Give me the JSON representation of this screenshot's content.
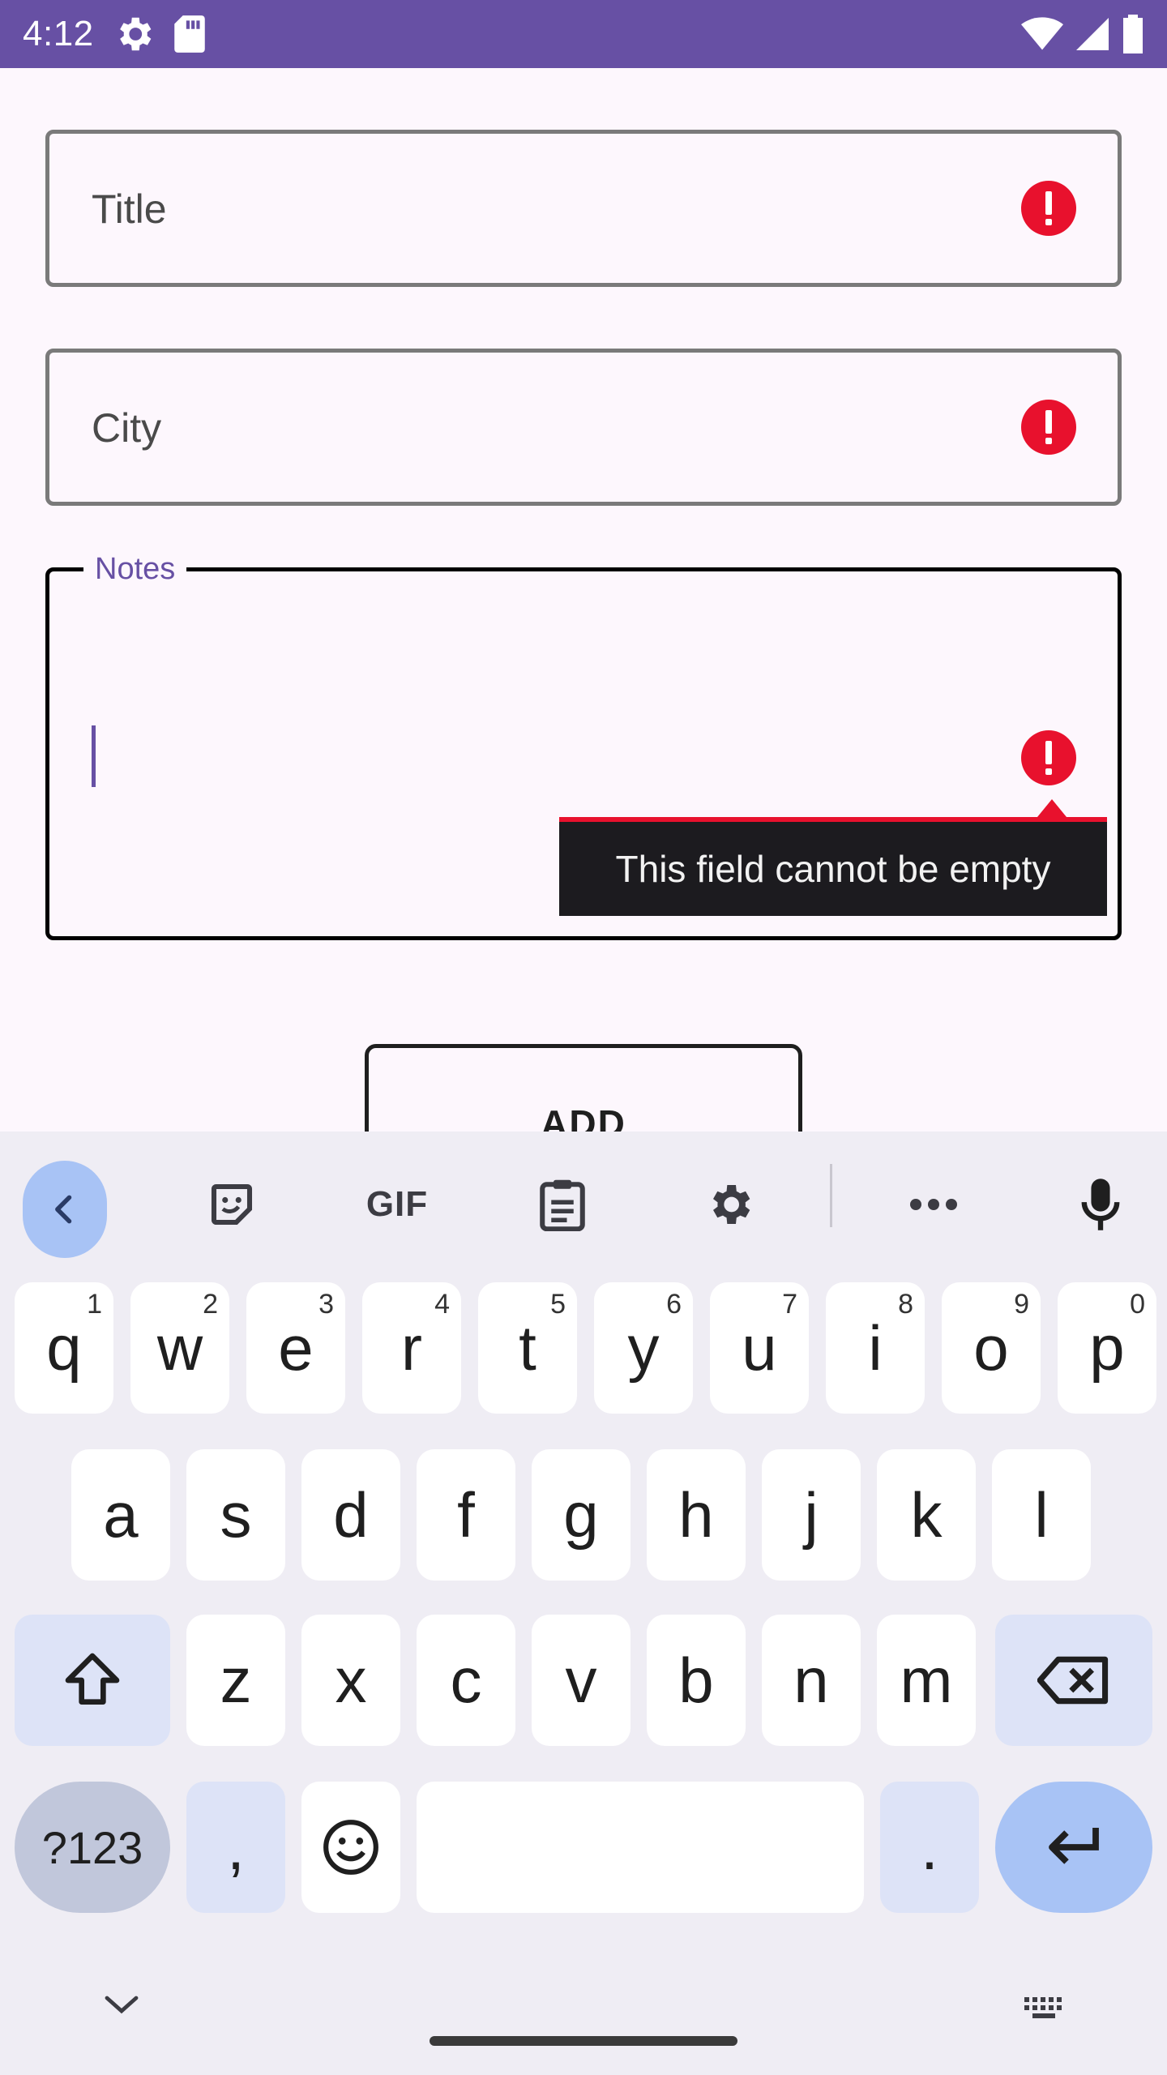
{
  "status_bar": {
    "time": "4:12",
    "left_icons": [
      "settings-icon",
      "sd-card-icon"
    ],
    "right_icons": [
      "wifi-icon",
      "signal-icon",
      "battery-icon"
    ],
    "background": "#6750a4"
  },
  "form": {
    "title_field": {
      "label": "Title",
      "error": true
    },
    "city_field": {
      "label": "City",
      "error": true
    },
    "notes_field": {
      "label": "Notes",
      "value": "",
      "focused": true,
      "error": true
    },
    "error_tooltip": "This field cannot be empty",
    "add_button_label": "ADD"
  },
  "colors": {
    "accent": "#6750a4",
    "error": "#e8112d",
    "tooltip_bg": "#1c1b1f"
  },
  "keyboard": {
    "toolbar": [
      "back-icon",
      "sticker-icon",
      "GIF",
      "clipboard-icon",
      "settings-icon",
      "more-icon",
      "mic-icon"
    ],
    "gif_label": "GIF",
    "row1": [
      {
        "key": "q",
        "hint": "1"
      },
      {
        "key": "w",
        "hint": "2"
      },
      {
        "key": "e",
        "hint": "3"
      },
      {
        "key": "r",
        "hint": "4"
      },
      {
        "key": "t",
        "hint": "5"
      },
      {
        "key": "y",
        "hint": "6"
      },
      {
        "key": "u",
        "hint": "7"
      },
      {
        "key": "i",
        "hint": "8"
      },
      {
        "key": "o",
        "hint": "9"
      },
      {
        "key": "p",
        "hint": "0"
      }
    ],
    "row2": [
      "a",
      "s",
      "d",
      "f",
      "g",
      "h",
      "j",
      "k",
      "l"
    ],
    "row3": [
      "z",
      "x",
      "c",
      "v",
      "b",
      "n",
      "m"
    ],
    "symbols_label": "?123",
    "comma_label": ",",
    "period_label": "."
  }
}
